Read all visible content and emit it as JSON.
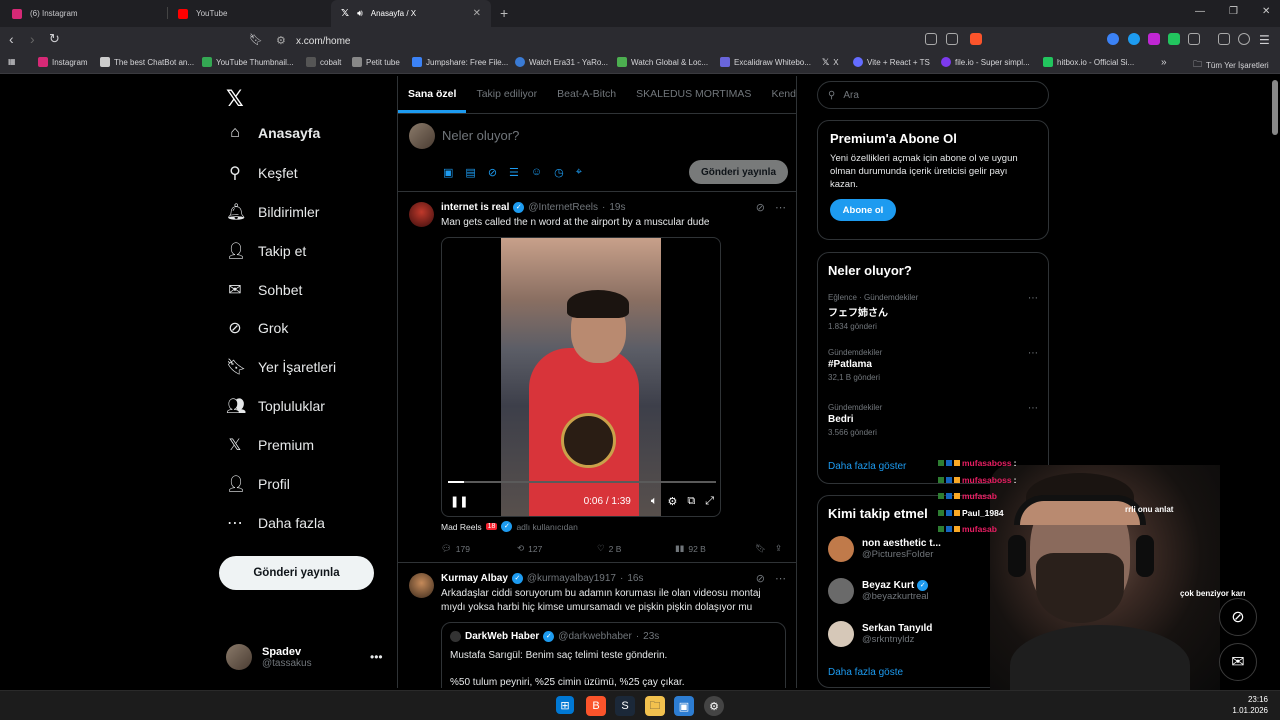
{
  "browser": {
    "tabs": [
      {
        "title": "(6) Instagram",
        "color": "#d62976"
      },
      {
        "title": "YouTube",
        "color": "#ff0000"
      },
      {
        "title": "Anasayfa / X",
        "color": "#000000"
      }
    ],
    "url": "x.com/home",
    "bookmarks": [
      {
        "label": "Instagram",
        "color": "#d62976"
      },
      {
        "label": "The best ChatBot an...",
        "color": "#cccccc"
      },
      {
        "label": "YouTube Thumbnail...",
        "color": "#34a853"
      },
      {
        "label": "cobalt",
        "color": "#222222"
      },
      {
        "label": "Petit tube",
        "color": "#888888"
      },
      {
        "label": "Jumpshare: Free File...",
        "color": "#3b82f6"
      },
      {
        "label": "Watch Era31 - YaRo...",
        "color": "#3a7bd5"
      },
      {
        "label": "Watch Global & Loc...",
        "color": "#4caf50"
      },
      {
        "label": "Excalidraw Whitebo...",
        "color": "#6965db"
      },
      {
        "label": "X",
        "color": "#000000"
      },
      {
        "label": "Vite + React + TS",
        "color": "#646cff"
      },
      {
        "label": "file.io - Super simpl...",
        "color": "#7c3aed"
      },
      {
        "label": "hitbox.io - Official Si...",
        "color": "#22c55e"
      }
    ],
    "bookmarks_folder": "Tüm Yer İşaretleri"
  },
  "nav": {
    "items": [
      {
        "label": "Anasayfa",
        "icon": "home-icon",
        "glyph": "⌂"
      },
      {
        "label": "Keşfet",
        "icon": "search-icon",
        "glyph": "⚲"
      },
      {
        "label": "Bildirimler",
        "icon": "bell-icon",
        "glyph": "🔔︎"
      },
      {
        "label": "Takip et",
        "icon": "follow-icon",
        "glyph": "👤︎"
      },
      {
        "label": "Sohbet",
        "icon": "mail-icon",
        "glyph": "✉"
      },
      {
        "label": "Grok",
        "icon": "grok-icon",
        "glyph": "⊘"
      },
      {
        "label": "Yer İşaretleri",
        "icon": "bookmark-icon",
        "glyph": "🔖︎"
      },
      {
        "label": "Topluluklar",
        "icon": "communities-icon",
        "glyph": "👥︎"
      },
      {
        "label": "Premium",
        "icon": "x-premium-icon",
        "glyph": "𝕏"
      },
      {
        "label": "Profil",
        "icon": "profile-icon",
        "glyph": "👤︎"
      },
      {
        "label": "Daha fazla",
        "icon": "more-icon",
        "glyph": "⋯"
      }
    ],
    "post_button": "Gönderi yayınla",
    "user": {
      "name": "Spadev",
      "handle": "@tassakus"
    }
  },
  "feed": {
    "tabs": [
      "Sana özel",
      "Takip ediliyor",
      "Beat-A-Bitch",
      "SKALEDUS MORTIMAS",
      "Kend"
    ],
    "compose_placeholder": "Neler oluyor?",
    "compose_button": "Gönderi yayınla",
    "tweets": [
      {
        "name": "internet is real",
        "handle": "@InternetReels",
        "time": "19s",
        "text": "Man gets called the n word at the airport by a muscular dude",
        "video_time": "0:06 / 1:39",
        "video_progress": 0.06,
        "source": "Mad Reels",
        "age_badge": "18",
        "source_suffix": "adlı kullanıcıdan",
        "replies": "179",
        "reposts": "127",
        "likes": "2 B",
        "views": "92 B"
      },
      {
        "name": "Kurmay Albay",
        "handle": "@kurmayalbay1917",
        "time": "16s",
        "text": "Arkadaşlar ciddi soruyorum bu adamın koruması ile olan videosu montaj mıydı yoksa harbi hiç kimse umursamadı ve pişkin pişkin dolaşıyor mu",
        "quote": {
          "name": "DarkWeb Haber",
          "handle": "@darkwebhaber",
          "time": "23s",
          "text": "Mustafa Sarıgül: Benim saç telimi teste gönderin.",
          "text2": "%50 tulum peyniri, %25 cimin üzümü, %25 çay çıkar."
        }
      }
    ]
  },
  "sidebar": {
    "search_placeholder": "Ara",
    "premium": {
      "title": "Premium'a Abone Ol",
      "desc": "Yeni özellikleri açmak için abone ol ve uygun olman durumunda içerik üreticisi gelir payı kazan.",
      "button": "Abone ol"
    },
    "trends": {
      "title": "Neler oluyor?",
      "items": [
        {
          "category": "Eğlence · Gündemdekiler",
          "name": "フェフ姉さん",
          "posts": "1.834 gönderi"
        },
        {
          "category": "Gündemdekiler",
          "name": "#Patlama",
          "posts": "32,1 B gönderi"
        },
        {
          "category": "Gündemdekiler",
          "name": "Bedri",
          "posts": "3.566 gönderi"
        }
      ],
      "more": "Daha fazla göster"
    },
    "follow": {
      "title": "Kimi takip etmel",
      "users": [
        {
          "name": "non aesthetic t...",
          "handle": "@PicturesFoIder",
          "color": "#c07a4a"
        },
        {
          "name": "Beyaz Kurt",
          "handle": "@beyazkurtreal",
          "color": "#6a6a6a"
        },
        {
          "name": "Serkan Tanyıld",
          "handle": "@srkntnyldz",
          "color": "#d6c8b8"
        }
      ],
      "more": "Daha fazla göste"
    }
  },
  "overlay": {
    "chat": [
      {
        "user": "mufasaboss",
        "color": "#e91e63"
      },
      {
        "user": "mufasaboss",
        "color": "#e91e63"
      },
      {
        "user": "mufasab",
        "color": "#e91e63"
      },
      {
        "user": "Paul_1984",
        "color": "#ffffff"
      },
      {
        "user": "mufasab",
        "color": "#e91e63"
      }
    ],
    "chat_right_1": "rrli onu anlat",
    "chat_right_2": "çok benziyor karı"
  },
  "taskbar": {
    "time": "23:16",
    "date": "1.01.2026"
  }
}
